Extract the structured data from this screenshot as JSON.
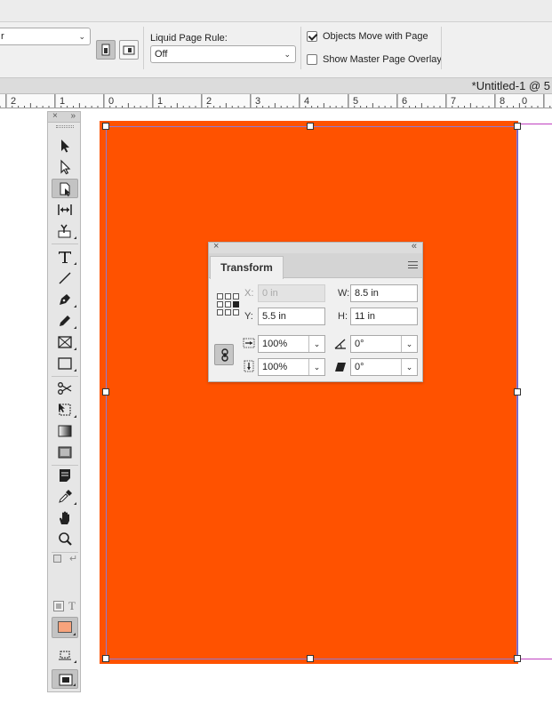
{
  "control_bar": {
    "top_select_value": "r",
    "liquid_page_rule_label": "Liquid Page Rule:",
    "liquid_page_rule_value": "Off",
    "objects_move_label": "Objects Move with Page",
    "objects_move_checked": true,
    "show_master_label": "Show Master Page Overlay",
    "show_master_checked": false
  },
  "document": {
    "title": "*Untitled-1 @ 5"
  },
  "ruler": {
    "labels": [
      "2",
      "1",
      "0",
      "1",
      "2",
      "3",
      "4",
      "5",
      "6",
      "7",
      "8",
      "0"
    ]
  },
  "tools": [
    {
      "name": "selection-tool",
      "icon": "arrow-solid"
    },
    {
      "name": "direct-selection-tool",
      "icon": "arrow-hollow"
    },
    {
      "name": "page-tool",
      "icon": "page",
      "active": true
    },
    {
      "name": "gap-tool",
      "icon": "gap"
    },
    {
      "name": "content-collector-tool",
      "icon": "collector"
    },
    {
      "name": "type-tool",
      "icon": "T"
    },
    {
      "name": "line-tool",
      "icon": "line"
    },
    {
      "name": "pen-tool",
      "icon": "pen"
    },
    {
      "name": "pencil-tool",
      "icon": "pencil"
    },
    {
      "name": "rectangle-frame-tool",
      "icon": "frame-x"
    },
    {
      "name": "rectangle-tool",
      "icon": "rect"
    },
    {
      "name": "scissors-tool",
      "icon": "scissors"
    },
    {
      "name": "free-transform-tool",
      "icon": "free-transform"
    },
    {
      "name": "gradient-swatch-tool",
      "icon": "gradient"
    },
    {
      "name": "gradient-feather-tool",
      "icon": "feather"
    },
    {
      "name": "note-tool",
      "icon": "note"
    },
    {
      "name": "eyedropper-tool",
      "icon": "eyedropper"
    },
    {
      "name": "hand-tool",
      "icon": "hand"
    },
    {
      "name": "zoom-tool",
      "icon": "zoom"
    }
  ],
  "tools_panel": {
    "format_text_label": "T"
  },
  "colors": {
    "page_fill": "#ff5200",
    "fill_swatch": "#f7a37c",
    "selection": "#8d7bd6"
  },
  "transform": {
    "tab_label": "Transform",
    "x_label": "X:",
    "x_value": "0 in",
    "y_label": "Y:",
    "y_value": "5.5 in",
    "w_label": "W:",
    "w_value": "8.5 in",
    "h_label": "H:",
    "h_value": "11 in",
    "scale_x_value": "100%",
    "scale_y_value": "100%",
    "rotate_value": "0°",
    "shear_value": "0°"
  }
}
